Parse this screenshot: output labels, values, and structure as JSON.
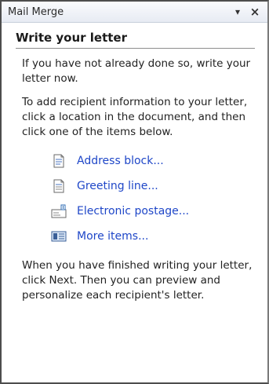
{
  "pane": {
    "title": "Mail Merge",
    "dropdown_glyph": "▾",
    "close_glyph": "×"
  },
  "section": {
    "heading": "Write your letter",
    "intro": "If you have not already done so, write your letter now.",
    "instructions": "To add recipient information to your letter, click a location in the document, and then click one of the items below."
  },
  "items": [
    {
      "label": "Address block...",
      "icon": "address-block-icon"
    },
    {
      "label": "Greeting line...",
      "icon": "greeting-line-icon"
    },
    {
      "label": "Electronic postage...",
      "icon": "electronic-postage-icon"
    },
    {
      "label": "More items...",
      "icon": "more-items-icon"
    }
  ],
  "footer": {
    "text": "When you have finished writing your letter, click Next. Then you can preview and personalize each recipient's letter."
  },
  "colors": {
    "link": "#1f47c8",
    "border": "#4d4d4d",
    "heading_rule": "#8d8d8d"
  }
}
